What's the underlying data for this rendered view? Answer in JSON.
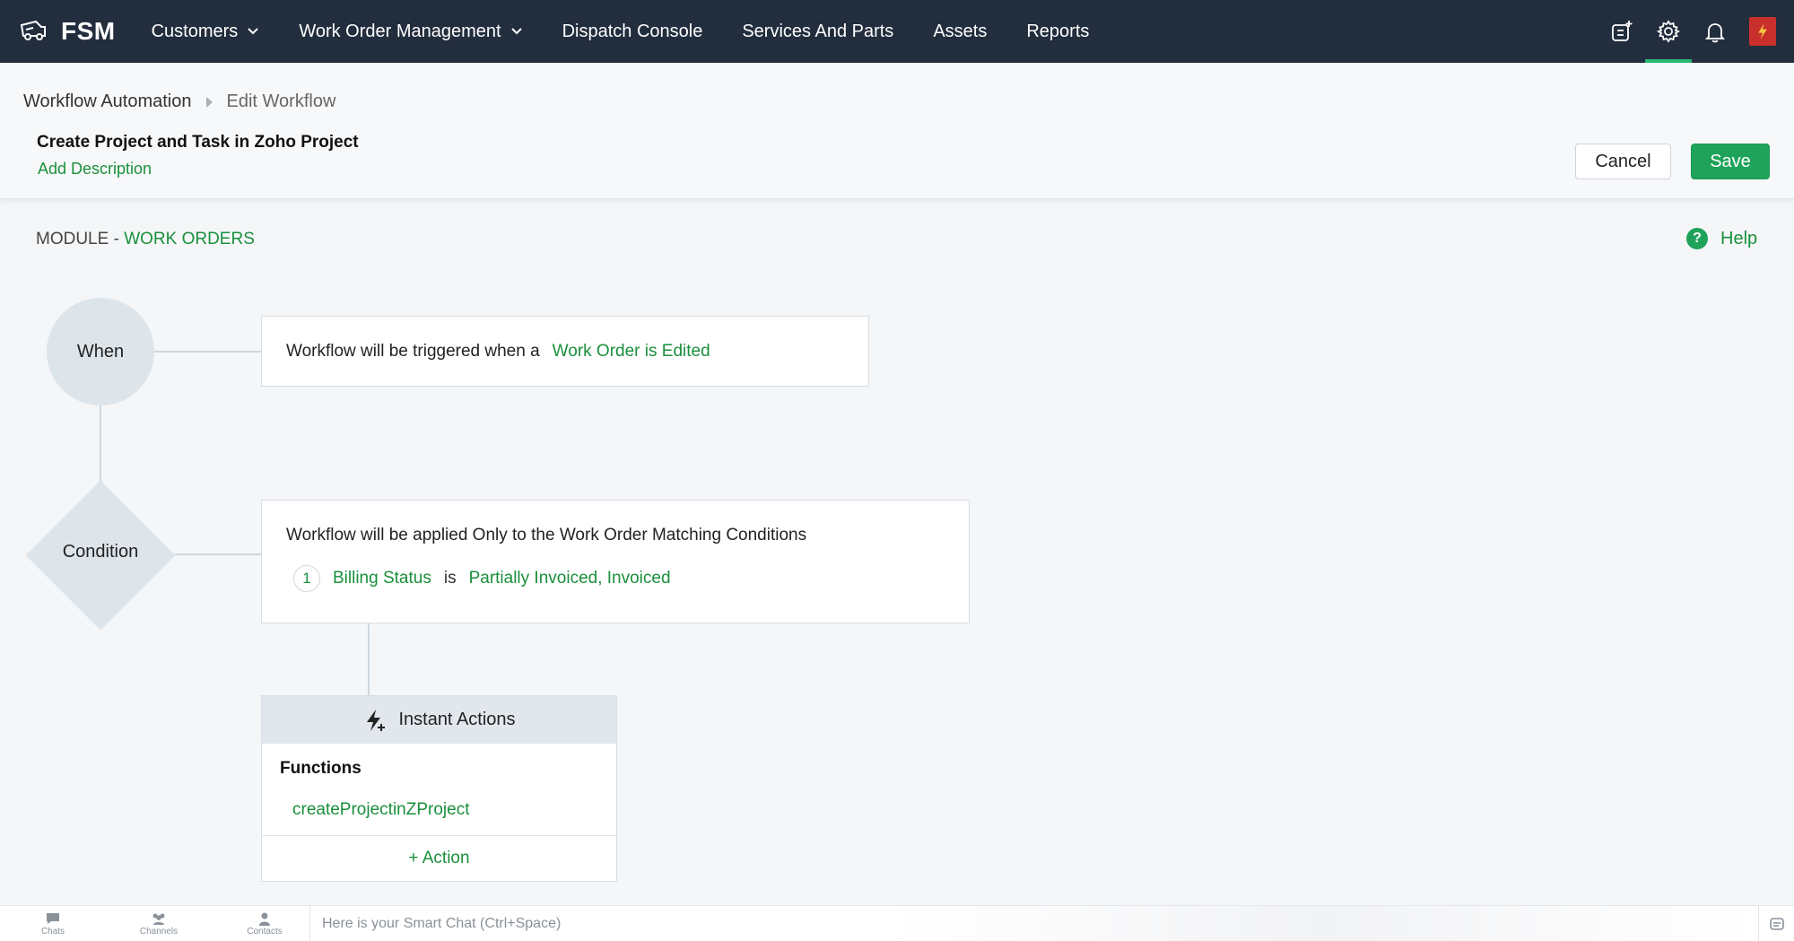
{
  "nav": {
    "brand": "FSM",
    "menu": [
      {
        "label": "Customers",
        "dropdown": true
      },
      {
        "label": "Work Order Management",
        "dropdown": true
      },
      {
        "label": "Dispatch Console",
        "dropdown": false
      },
      {
        "label": "Services And Parts",
        "dropdown": false
      },
      {
        "label": "Assets",
        "dropdown": false
      },
      {
        "label": "Reports",
        "dropdown": false
      }
    ],
    "icons": [
      "new-item-icon",
      "settings-icon",
      "bell-icon",
      "avatar"
    ],
    "active_icon": "settings-icon"
  },
  "header": {
    "breadcrumb_parent": "Workflow Automation",
    "breadcrumb_current": "Edit Workflow",
    "workflow_title": "Create Project and Task in Zoho Project",
    "add_description": "Add Description",
    "cancel_label": "Cancel",
    "save_label": "Save"
  },
  "module": {
    "prefix": "MODULE - ",
    "name": "WORK ORDERS",
    "help_icon": "?",
    "help_label": "Help"
  },
  "flow": {
    "when_label": "When",
    "condition_label": "Condition",
    "trigger_text": "Workflow will be triggered when a",
    "trigger_event": "Work Order is Edited",
    "condition_heading": "Workflow will be applied Only to the Work Order Matching Conditions",
    "conditions": [
      {
        "index": "1",
        "field": "Billing Status",
        "operator": "is",
        "value": "Partially Invoiced, Invoiced"
      }
    ],
    "actions": {
      "title": "Instant Actions",
      "functions_label": "Functions",
      "function_name": "createProjectinZProject",
      "add_action": "+ Action"
    }
  },
  "bottom": {
    "tabs": [
      "Chats",
      "Channels",
      "Contacts"
    ],
    "smartchat_placeholder": "Here is your Smart Chat (Ctrl+Space)"
  },
  "colors": {
    "nav_bg": "#222d3d",
    "accent_green": "#1a8f3c",
    "save_green": "#1fa35a",
    "node_gray": "#dde4ea"
  }
}
